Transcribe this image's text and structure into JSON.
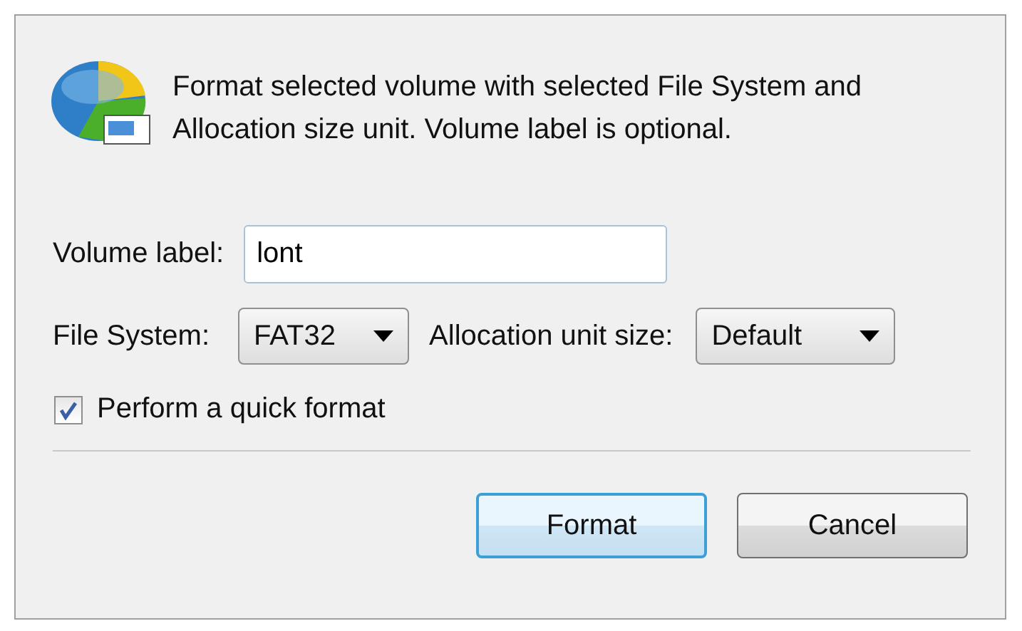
{
  "message": "Format selected volume with selected File System and Allocation size unit. Volume label is optional.",
  "volume_label": {
    "label": "Volume label:",
    "value": "lont"
  },
  "file_system": {
    "label": "File System:",
    "value": "FAT32"
  },
  "allocation_unit_size": {
    "label": "Allocation unit size:",
    "value": "Default"
  },
  "quick_format": {
    "label": "Perform a quick format",
    "checked": true
  },
  "buttons": [
    {
      "label": "Format",
      "default": true
    },
    {
      "label": "Cancel",
      "default": false
    }
  ]
}
